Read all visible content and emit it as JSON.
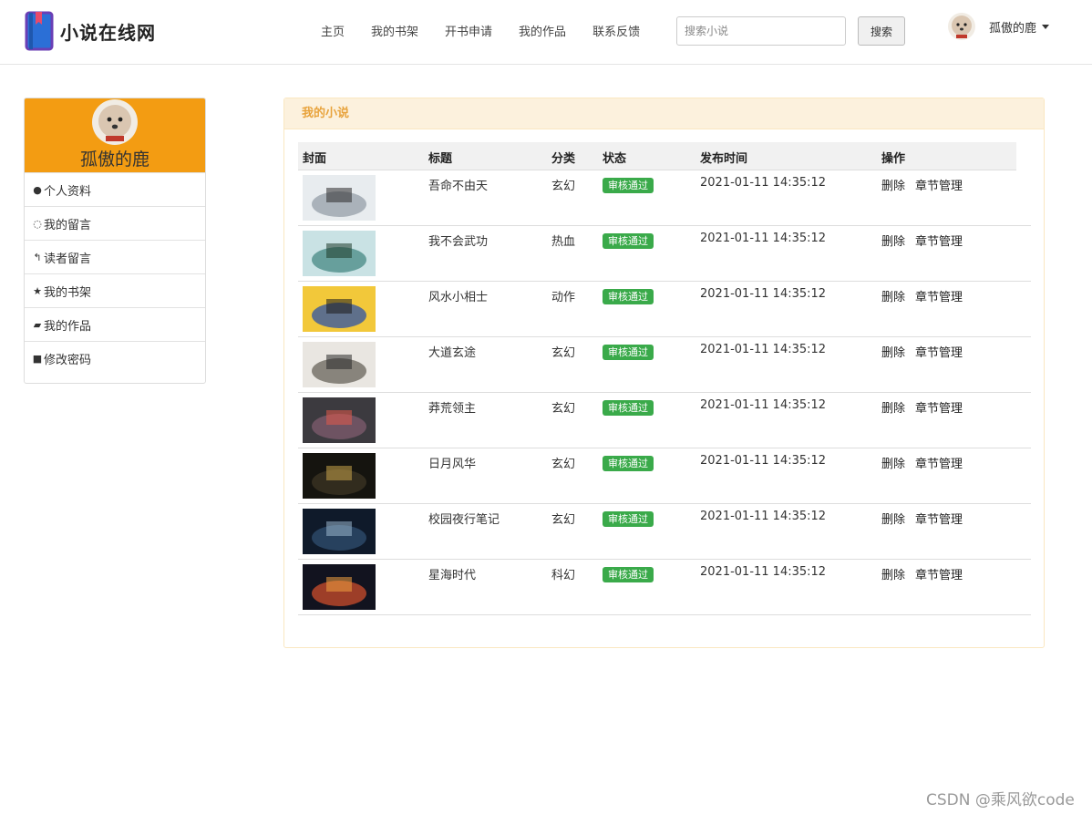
{
  "brand": {
    "title": "小说在线网"
  },
  "nav": {
    "items": [
      "主页",
      "我的书架",
      "开书申请",
      "我的作品",
      "联系反馈"
    ]
  },
  "search": {
    "placeholder": "搜索小说",
    "button": "搜索"
  },
  "user": {
    "name": "孤傲的鹿"
  },
  "sidebar": {
    "name": "孤傲的鹿",
    "items": [
      {
        "icon": "user-icon",
        "label": "个人资料"
      },
      {
        "icon": "comment-icon",
        "label": "我的留言"
      },
      {
        "icon": "reply-icon",
        "label": "读者留言"
      },
      {
        "icon": "star-icon",
        "label": "我的书架"
      },
      {
        "icon": "book-icon",
        "label": "我的作品"
      },
      {
        "icon": "lock-icon",
        "label": "修改密码"
      }
    ]
  },
  "panel": {
    "title": "我的小说",
    "headers": [
      "封面",
      "标题",
      "分类",
      "状态",
      "发布时间",
      "操作"
    ],
    "rows": [
      {
        "title": "吾命不由天",
        "category": "玄幻",
        "status": "审核通过",
        "time": "2021-01-11 14:35:12",
        "delete": "删除",
        "manage": "章节管理"
      },
      {
        "title": "我不会武功",
        "category": "热血",
        "status": "审核通过",
        "time": "2021-01-11 14:35:12",
        "delete": "删除",
        "manage": "章节管理"
      },
      {
        "title": "风水小相士",
        "category": "动作",
        "status": "审核通过",
        "time": "2021-01-11 14:35:12",
        "delete": "删除",
        "manage": "章节管理"
      },
      {
        "title": "大道玄途",
        "category": "玄幻",
        "status": "审核通过",
        "time": "2021-01-11 14:35:12",
        "delete": "删除",
        "manage": "章节管理"
      },
      {
        "title": "莽荒领主",
        "category": "玄幻",
        "status": "审核通过",
        "time": "2021-01-11 14:35:12",
        "delete": "删除",
        "manage": "章节管理"
      },
      {
        "title": "日月风华",
        "category": "玄幻",
        "status": "审核通过",
        "time": "2021-01-11 14:35:12",
        "delete": "删除",
        "manage": "章节管理"
      },
      {
        "title": "校园夜行笔记",
        "category": "玄幻",
        "status": "审核通过",
        "time": "2021-01-11 14:35:12",
        "delete": "删除",
        "manage": "章节管理"
      },
      {
        "title": "星海时代",
        "category": "科幻",
        "status": "审核通过",
        "time": "2021-01-11 14:35:12",
        "delete": "删除",
        "manage": "章节管理"
      }
    ]
  },
  "colors": {
    "accent": "#f39c12",
    "success": "#3aaa4a",
    "panel_title": "#e8a33c"
  },
  "watermark": "CSDN @乘风欲code"
}
